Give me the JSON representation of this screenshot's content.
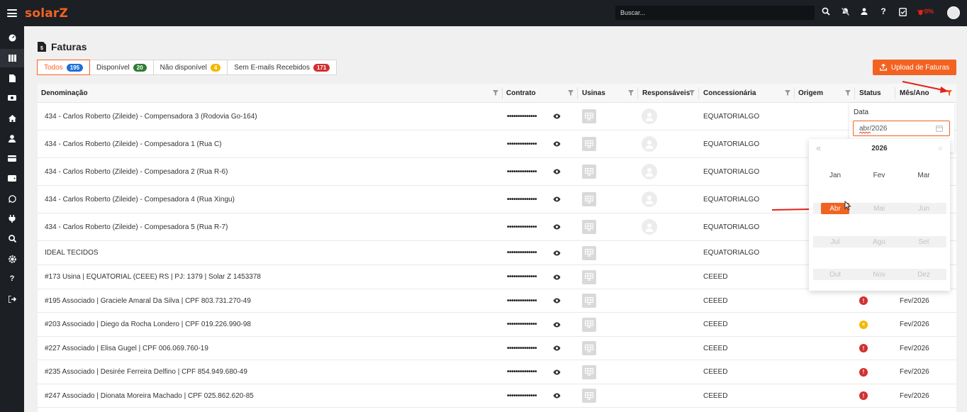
{
  "topbar": {
    "logo": "solarZ",
    "search_placeholder": "Buscar...",
    "alert_percent": "0%"
  },
  "page": {
    "title": "Faturas"
  },
  "tabs": [
    {
      "label": "Todos",
      "count": "195",
      "color": "#1e6fd9"
    },
    {
      "label": "Disponível",
      "count": "20",
      "color": "#2e7d32"
    },
    {
      "label": "Não disponível",
      "count": "4",
      "color": "#f5b800"
    },
    {
      "label": "Sem E-mails Recebidos",
      "count": "171",
      "color": "#d32f2f"
    }
  ],
  "upload_label": "Upload de Faturas",
  "columns": [
    "Denominação",
    "Contrato",
    "Usinas",
    "Responsáveis",
    "Concessionária",
    "Origem",
    "Status",
    "Mês/Ano"
  ],
  "rows": [
    {
      "name": "434 - Carlos Roberto (Zileide) - Compensadora 3 (Rodovia Go-164)",
      "contract": "••••••••••••••",
      "conc": "EQUATORIALGO",
      "resp": true,
      "status": "",
      "date": ""
    },
    {
      "name": "434 - Carlos Roberto (Zileide) - Compesadora 1 (Rua C)",
      "contract": "••••••••••••••",
      "conc": "EQUATORIALGO",
      "resp": true,
      "status": "",
      "date": ""
    },
    {
      "name": "434 - Carlos Roberto (Zileide) - Compesadora 2 (Rua R-6)",
      "contract": "••••••••••••••",
      "conc": "EQUATORIALGO",
      "resp": true,
      "status": "",
      "date": ""
    },
    {
      "name": "434 - Carlos Roberto (Zileide) - Compesadora 4 (Rua Xingu)",
      "contract": "••••••••••••••",
      "conc": "EQUATORIALGO",
      "resp": true,
      "status": "",
      "date": ""
    },
    {
      "name": "434 - Carlos Roberto (Zileide) - Compesadora 5 (Rua R-7)",
      "contract": "••••••••••••••",
      "conc": "EQUATORIALGO",
      "resp": true,
      "status": "",
      "date": ""
    },
    {
      "name": "IDEAL TECIDOS",
      "contract": "••••••••••••••",
      "conc": "EQUATORIALGO",
      "resp": false,
      "status": "",
      "date": ""
    },
    {
      "name": "#173 Usina | EQUATORIAL (CEEE) RS | PJ: 1379 | Solar Z 1453378",
      "contract": "••••••••••••••",
      "conc": "CEEED",
      "resp": false,
      "status": "",
      "date": ""
    },
    {
      "name": "#195 Associado | Graciele Amaral Da Silva | CPF 803.731.270-49",
      "contract": "••••••••••••••",
      "conc": "CEEED",
      "resp": false,
      "status": "error",
      "date": "Fev/2026"
    },
    {
      "name": "#203 Associado | Diego da Rocha Londero | CPF 019.226.990-98",
      "contract": "••••••••••••••",
      "conc": "CEEED",
      "resp": false,
      "status": "warn",
      "date": "Fev/2026"
    },
    {
      "name": "#227 Associado | Elisa Gugel | CPF 006.069.760-19",
      "contract": "••••••••••••••",
      "conc": "CEEED",
      "resp": false,
      "status": "error",
      "date": "Fev/2026"
    },
    {
      "name": "#235 Associado | Desirée Ferreira Delfino | CPF 854.949.680-49",
      "contract": "••••••••••••••",
      "conc": "CEEED",
      "resp": false,
      "status": "error",
      "date": "Fev/2026"
    },
    {
      "name": "#247 Associado | Dionata Moreira Machado | CPF 025.862.620-85",
      "contract": "••••••••••••••",
      "conc": "CEEED",
      "resp": false,
      "status": "error",
      "date": "Fev/2026"
    }
  ],
  "filter": {
    "label": "Data",
    "value": "abr/2026",
    "year": "2026",
    "months": [
      "Jan",
      "Fev",
      "Mar",
      "Abr",
      "Mai",
      "Jun",
      "Jul",
      "Ago",
      "Set",
      "Out",
      "Nov",
      "Dez"
    ],
    "selected": "Abr"
  },
  "colors": {
    "accent": "#f26322",
    "error": "#d32f2f",
    "warning": "#f5b800"
  }
}
